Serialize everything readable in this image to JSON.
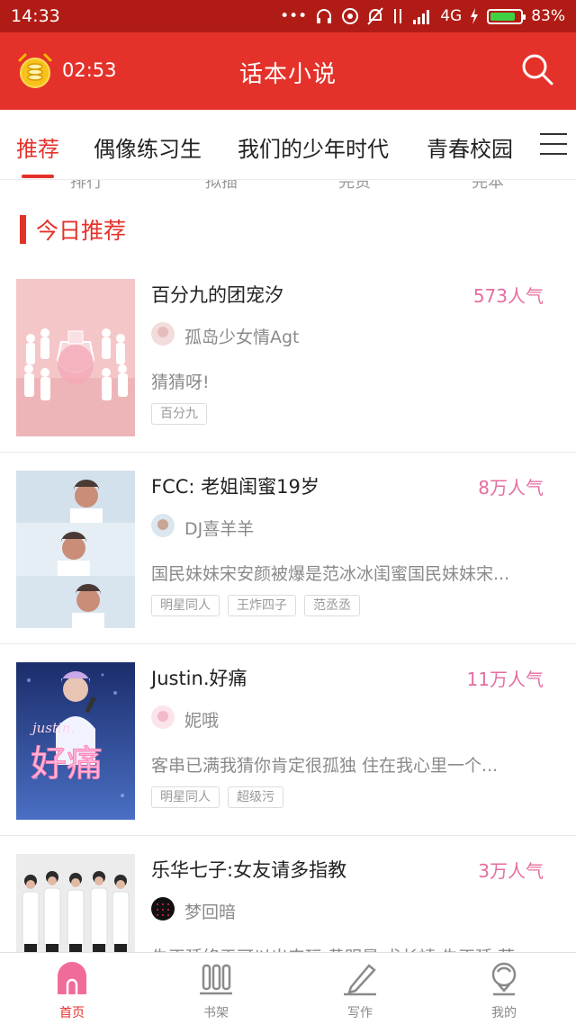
{
  "status_bar": {
    "time": "14:33",
    "dots": "•••",
    "network": "4G",
    "battery": "83%",
    "battery_level": 0.83
  },
  "header": {
    "countdown": "02:53",
    "title": "话本小说"
  },
  "tabs": [
    {
      "label": "推荐",
      "active": true
    },
    {
      "label": "偶像练习生",
      "active": false
    },
    {
      "label": "我们的少年时代",
      "active": false
    },
    {
      "label": "青春校园",
      "active": false
    }
  ],
  "peek_row": [
    "排行",
    "拟插",
    "完责",
    "完本"
  ],
  "section": {
    "title": "今日推荐"
  },
  "books": [
    {
      "title": "百分九的团宠汐",
      "popularity": "573人气",
      "author": "孤岛少女情Agt",
      "description": "猜猜呀!",
      "tags": [
        "百分九"
      ]
    },
    {
      "title": "FCC: 老姐闺蜜19岁",
      "popularity": "8万人气",
      "author": "DJ喜羊羊",
      "description": "国民妹妹宋安颜被爆是范冰冰闺蜜国民妹妹宋...",
      "tags": [
        "明星同人",
        "王炸四子",
        "范丞丞"
      ]
    },
    {
      "title": "Justin.好痛",
      "popularity": "11万人气",
      "author": "妮哦",
      "description": "客串已满我猜你肯定很孤独 住在我心里一个...",
      "tags": [
        "明星同人",
        "超级污"
      ],
      "cover_text_top": "justin.",
      "cover_text_main": "好痛"
    },
    {
      "title": "乐华七子:女友请多指教",
      "popularity": "3万人气",
      "author": "梦回暗",
      "description": "朱正廷终于可以出来玩 黄明昊 尤长靖 朱正廷 范...",
      "tags": []
    }
  ],
  "bottom_nav": [
    {
      "label": "首页",
      "active": true
    },
    {
      "label": "书架",
      "active": false
    },
    {
      "label": "写作",
      "active": false
    },
    {
      "label": "我的",
      "active": false
    }
  ],
  "colors": {
    "status_bar": "#b01c15",
    "brand_red": "#e4322b",
    "popularity_pink": "#e46ea0",
    "muted_text": "#8a8a8a"
  }
}
